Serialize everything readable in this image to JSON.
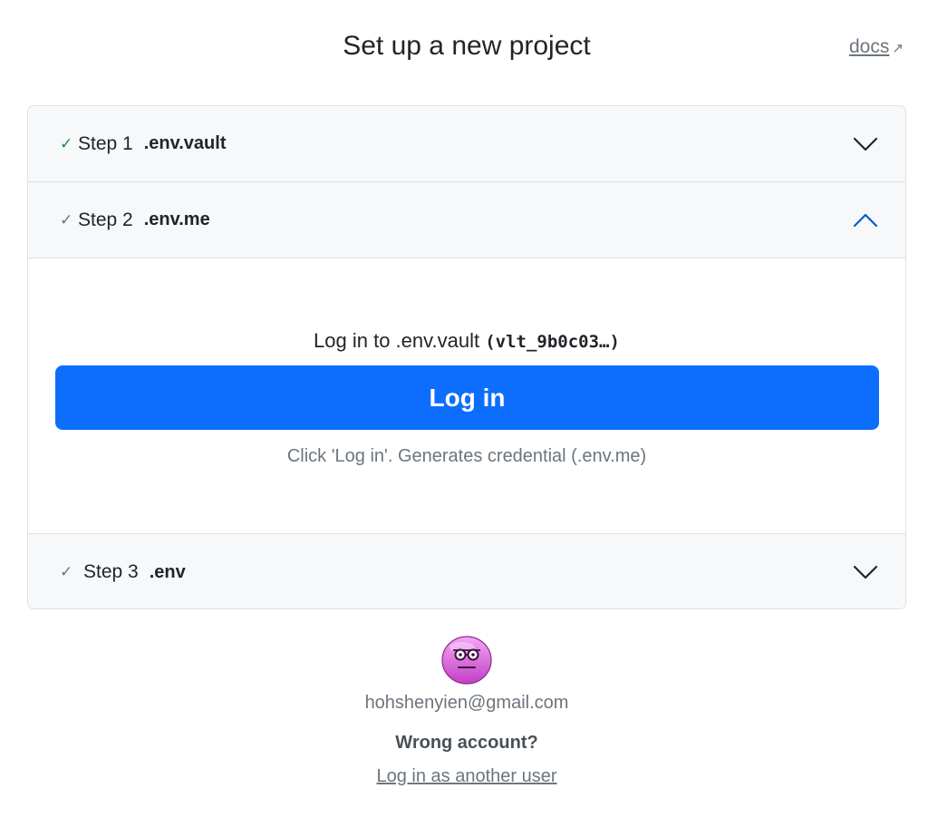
{
  "header": {
    "title": "Set up a new project",
    "docs_label": "docs",
    "docs_icon": "external-link-icon"
  },
  "steps": [
    {
      "check": "✓",
      "label": "Step 1",
      "name": ".env.vault",
      "expanded": false,
      "check_color": "#198754"
    },
    {
      "check": "✓",
      "label": "Step 2",
      "name": ".env.me",
      "expanded": true,
      "check_color": "#6c757d"
    },
    {
      "check": "✓",
      "label": "Step 3",
      "name": ".env",
      "expanded": false,
      "check_color": "#6c757d"
    }
  ],
  "step2_body": {
    "prompt_text": "Log in to .env.vault",
    "vault_id": "(vlt_9b0c03…)",
    "button_label": "Log in",
    "help_text": "Click 'Log in'. Generates credential (.env.me)"
  },
  "account": {
    "avatar": "nerd-face-avatar",
    "email": "hohshenyien@gmail.com",
    "wrong_account": "Wrong account?",
    "switch_link": "Log in as another user"
  },
  "colors": {
    "primary": "#0d6efd",
    "header_bg": "#f7f8fa",
    "muted": "#6c757d"
  }
}
